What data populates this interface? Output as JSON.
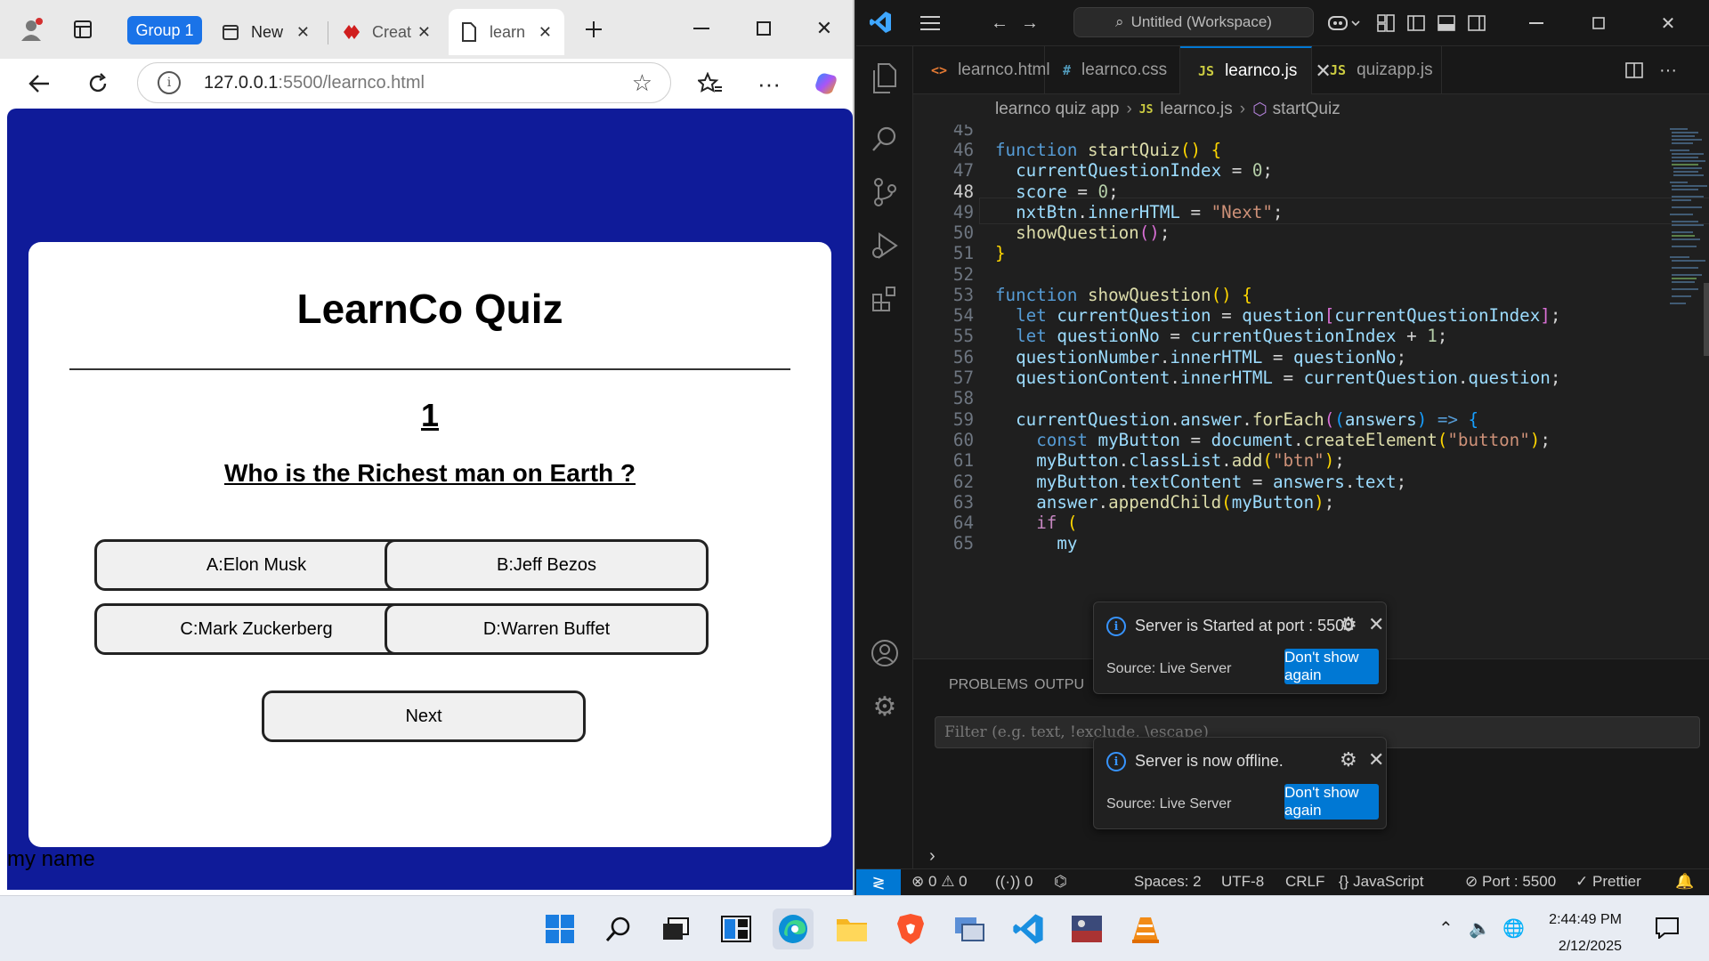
{
  "browser": {
    "group_label": "Group 1",
    "tabs": [
      {
        "label": "New",
        "icon": "calendar-icon"
      },
      {
        "label": "Creat",
        "icon": "brand-icon"
      },
      {
        "label": "learn",
        "icon": "page-icon"
      }
    ],
    "url_host": "127.0.0.1",
    "url_path": ":5500/learnco.html"
  },
  "quiz": {
    "title": "LearnCo Quiz",
    "question_number": "1",
    "question": "Who is the Richest man on Earth ?",
    "answers": [
      "A:Elon Musk",
      "B:Jeff Bezos",
      "C:Mark Zuckerberg",
      "D:Warren Buffet"
    ],
    "next_label": "Next",
    "footer_text": "my name",
    "background_color": "#0f1b99"
  },
  "vscode": {
    "search_placeholder": "Untitled (Workspace)",
    "tabs": [
      {
        "label": "learnco.html",
        "icon": "<>"
      },
      {
        "label": "learnco.css",
        "icon": "#"
      },
      {
        "label": "learnco.js",
        "icon": "JS"
      },
      {
        "label": "quizapp.js",
        "icon": "JS"
      }
    ],
    "breadcrumb": [
      "learnco quiz app",
      "learnco.js",
      "startQuiz"
    ],
    "code_lines": [
      {
        "n": "45"
      },
      {
        "n": "46"
      },
      {
        "n": "47"
      },
      {
        "n": "48"
      },
      {
        "n": "49"
      },
      {
        "n": "50"
      },
      {
        "n": "51"
      },
      {
        "n": "52"
      },
      {
        "n": "53"
      },
      {
        "n": "54"
      },
      {
        "n": "55"
      },
      {
        "n": "56"
      },
      {
        "n": "57"
      },
      {
        "n": "58"
      },
      {
        "n": "59"
      },
      {
        "n": "60"
      },
      {
        "n": "61"
      },
      {
        "n": "62"
      },
      {
        "n": "63"
      },
      {
        "n": "64"
      },
      {
        "n": "65"
      }
    ],
    "panel_tabs": [
      "PROBLEMS",
      "OUTPU"
    ],
    "filter_placeholder": "Filter (e.g. text, !exclude, \\escape)",
    "notifications": [
      {
        "message": "Server is Started at port : 5500",
        "source": "Source: Live Server",
        "button": "Don't show again"
      },
      {
        "message": "Server is now offline.",
        "source": "Source: Live Server",
        "button": "Don't show again"
      }
    ],
    "status": {
      "errors": "0",
      "warnings": "0",
      "ports": "0",
      "spaces": "Spaces: 2",
      "encoding": "UTF-8",
      "eol": "CRLF",
      "language": "JavaScript",
      "port": "Port : 5500",
      "prettier": "Prettier"
    },
    "accent_color": "#0078d4"
  },
  "taskbar": {
    "time": "2:44:49 PM",
    "date": "2/12/2025",
    "apps": [
      "start-icon",
      "search-icon",
      "task-view-icon",
      "widgets-icon",
      "edge-icon",
      "file-explorer-icon",
      "brave-icon",
      "network-app-icon",
      "vscode-icon",
      "photo-app-icon",
      "vlc-icon"
    ]
  }
}
